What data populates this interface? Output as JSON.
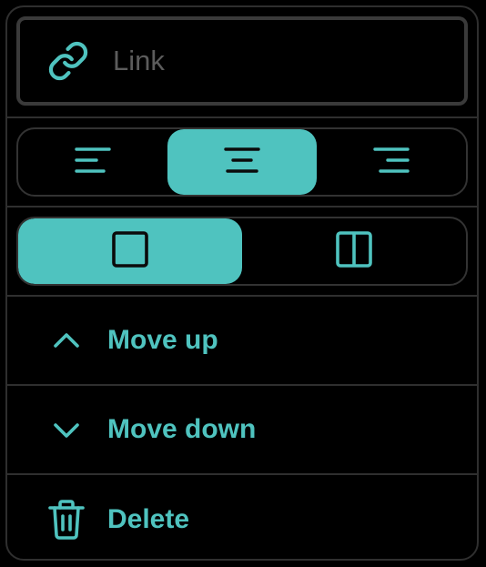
{
  "accent_color": "#4fc3bf",
  "link": {
    "placeholder": "Link",
    "icon": "link-icon"
  },
  "alignment": {
    "options": [
      {
        "icon": "align-left-icon",
        "selected": false
      },
      {
        "icon": "align-center-icon",
        "selected": true
      },
      {
        "icon": "align-right-icon",
        "selected": false
      }
    ]
  },
  "layout": {
    "options": [
      {
        "icon": "single-column-icon",
        "selected": true
      },
      {
        "icon": "two-column-icon",
        "selected": false
      }
    ]
  },
  "actions": [
    {
      "label": "Move up",
      "icon": "chevron-up-icon"
    },
    {
      "label": "Move down",
      "icon": "chevron-down-icon"
    },
    {
      "label": "Delete",
      "icon": "trash-icon"
    }
  ]
}
